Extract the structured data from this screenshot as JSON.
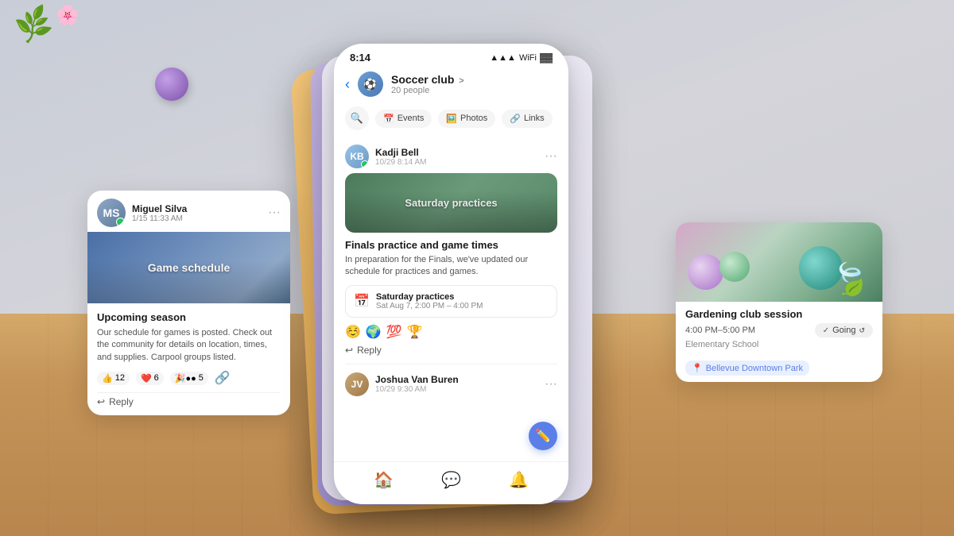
{
  "background": {
    "color": "#d8d8dc"
  },
  "decorative": {
    "plant_emoji": "🌿",
    "leaf_emoji": "🍃",
    "ball_color": "#9a60c8"
  },
  "card_left": {
    "user": {
      "name": "Miguel Silva",
      "avatar_initials": "MS",
      "timestamp": "1/15 11:33 AM",
      "online": true
    },
    "image_label": "Game schedule",
    "title": "Upcoming season",
    "body": "Our schedule for games is posted. Check out the community for details on location, times, and supplies. Carpool groups listed.",
    "reactions": [
      {
        "emoji": "👍",
        "count": "12"
      },
      {
        "emoji": "❤️",
        "count": "6"
      },
      {
        "emoji": "🎉",
        "count": "5"
      }
    ],
    "reply_label": "Reply",
    "dots_label": "···"
  },
  "phone": {
    "status_time": "8:14",
    "group_name": "Soccer club",
    "group_arrow": ">",
    "group_members": "20 people",
    "back_arrow": "‹",
    "tabs": [
      {
        "label": "Events",
        "icon": "📅",
        "active": false
      },
      {
        "label": "Photos",
        "icon": "🖼️",
        "active": false
      },
      {
        "label": "Links",
        "icon": "🔗",
        "active": false
      }
    ],
    "messages": [
      {
        "user_name": "Kadji Bell",
        "avatar_initials": "KB",
        "timestamp": "10/29 8:14 AM",
        "image_label": "Saturday practices",
        "title": "Finals practice and game times",
        "body": "In preparation for the Finals, we've updated our schedule for practices and games.",
        "event": {
          "title": "Saturday practices",
          "date": "Sat Aug 7, 2:00 PM – 4:00 PM"
        },
        "reactions": [
          "☺️",
          "🌍",
          "💯",
          "🏆"
        ],
        "reply_label": "Reply"
      },
      {
        "user_name": "Joshua Van Buren",
        "avatar_initials": "JV",
        "timestamp": "10/29 9:30 AM",
        "image_partial": true
      }
    ],
    "nav_items": [
      {
        "icon": "🏠",
        "label": "home",
        "active": true
      },
      {
        "icon": "💬",
        "label": "chat",
        "active": false
      },
      {
        "icon": "🔔",
        "label": "notifications",
        "active": false
      }
    ],
    "fab_icon": "✏️"
  },
  "card_right": {
    "title": "Gardening club session",
    "time": "4:00 PM–5:00 PM",
    "going_label": "Going",
    "location": "Elementary School",
    "location_tag": "Bellevue Downtown Park"
  }
}
